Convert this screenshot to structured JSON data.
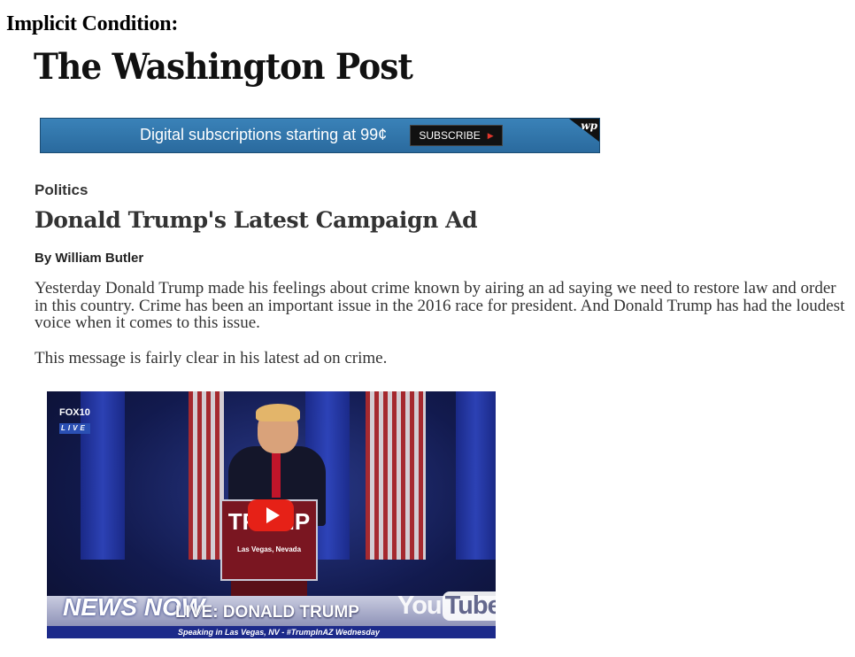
{
  "condition_label": "Implicit Condition:",
  "masthead": "The Washington Post",
  "banner": {
    "text": "Digital subscriptions starting at 99¢",
    "button_label": "SUBSCRIBE",
    "corner_mark": "wp"
  },
  "article": {
    "section": "Politics",
    "headline": "Donald Trump's Latest Campaign Ad",
    "byline": "By William Butler",
    "paragraphs": [
      "Yesterday Donald Trump made his feelings about crime known by airing an ad saying we need to restore law and order in this country. Crime has been an important issue in the 2016 race for president. And Donald Trump has had the loudest voice when it comes to this issue.",
      "This message is fairly clear in his latest ad on crime."
    ]
  },
  "video": {
    "channel_logo": "FOX10",
    "channel_sub": "LIVE",
    "podium_text": "TRUMP",
    "podium_location": "Las Vegas, Nevada",
    "news_now": "NEWS NOW",
    "title": "LIVE: DONALD TRUMP",
    "caption": "Speaking in Las Vegas, NV - #TrumpInAZ Wednesday",
    "yt_you": "You",
    "yt_tube": "Tube"
  },
  "colors": {
    "banner_blue": "#2f78b0",
    "play_red": "#e62117"
  }
}
